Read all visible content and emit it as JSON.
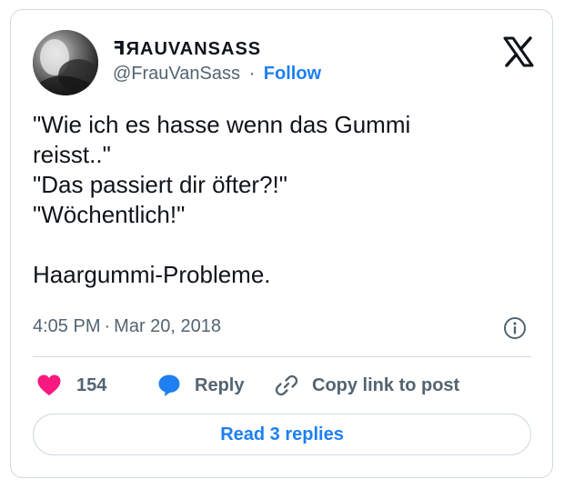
{
  "author": {
    "display_name": "ꟻЯAUVANSASS",
    "handle": "@FrauVanSass",
    "separator": "·",
    "follow_label": "Follow"
  },
  "tweet": {
    "text": "\"Wie ich es hasse wenn das Gummi\nreisst..\"\n\"Das passiert dir öfter?!\"\n\"Wöchentlich!\"\n\nHaargummi-Probleme.",
    "time": "4:05 PM",
    "separator": "·",
    "date": "Mar 20, 2018"
  },
  "actions": {
    "like_count": "154",
    "reply_label": "Reply",
    "copy_label": "Copy link to post"
  },
  "read_replies_label": "Read 3 replies",
  "icons": {
    "logo": "x-logo-icon",
    "info": "info-icon",
    "like": "heart-icon",
    "reply": "speech-bubble-icon",
    "copy": "link-icon"
  },
  "colors": {
    "accent": "#1d7ff0",
    "heart": "#f91880",
    "muted": "#536471",
    "text": "#0f1419",
    "border": "#cfd9de"
  }
}
